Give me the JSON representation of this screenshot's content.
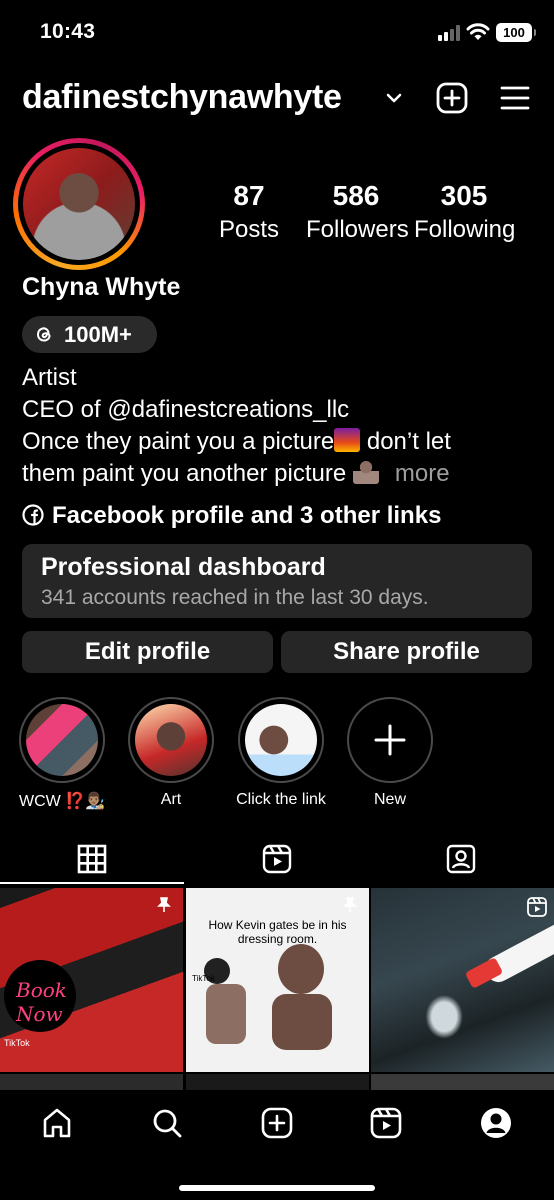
{
  "status_bar": {
    "time": "10:43",
    "battery": "100"
  },
  "header": {
    "username": "dafinestchynawhyte"
  },
  "profile": {
    "stats": [
      {
        "value": "87",
        "label": "Posts"
      },
      {
        "value": "586",
        "label": "Followers"
      },
      {
        "value": "305",
        "label": "Following"
      }
    ],
    "display_name": "Chyna Whyte",
    "threads_badge": "100M+",
    "bio": {
      "line1": "Artist",
      "line2": "CEO of @dafinestcreations_llc",
      "line3": "Once they paint you a picture",
      "line3_end": " don’t let",
      "line4": "them paint you another picture ",
      "more": "more"
    },
    "links": "Facebook profile and 3 other links"
  },
  "dashboard": {
    "title": "Professional dashboard",
    "subtitle": "341 accounts reached in the last 30 days."
  },
  "buttons": {
    "edit": "Edit profile",
    "share": "Share profile"
  },
  "highlights": [
    {
      "label": "WCW ⁉️👨🏽‍🎨"
    },
    {
      "label": "Art"
    },
    {
      "label": "Click the link"
    },
    {
      "label": "New"
    }
  ],
  "grid": {
    "post1": {
      "script": "Book Now",
      "tiktok": "TikTok"
    },
    "post2": {
      "caption": "How Kevin gates be in his dressing room.",
      "tiktok": "TikTok"
    }
  },
  "colors": {
    "background": "#000000",
    "surface": "#262626",
    "secondary_text": "#a8a8a8",
    "story_ring": [
      "#f9a825",
      "#e91e63"
    ]
  },
  "icons": {
    "tabs": [
      "grid-icon",
      "reels-icon",
      "tagged-icon"
    ],
    "nav": [
      "home-icon",
      "search-icon",
      "create-icon",
      "reels-icon",
      "profile-icon"
    ]
  }
}
